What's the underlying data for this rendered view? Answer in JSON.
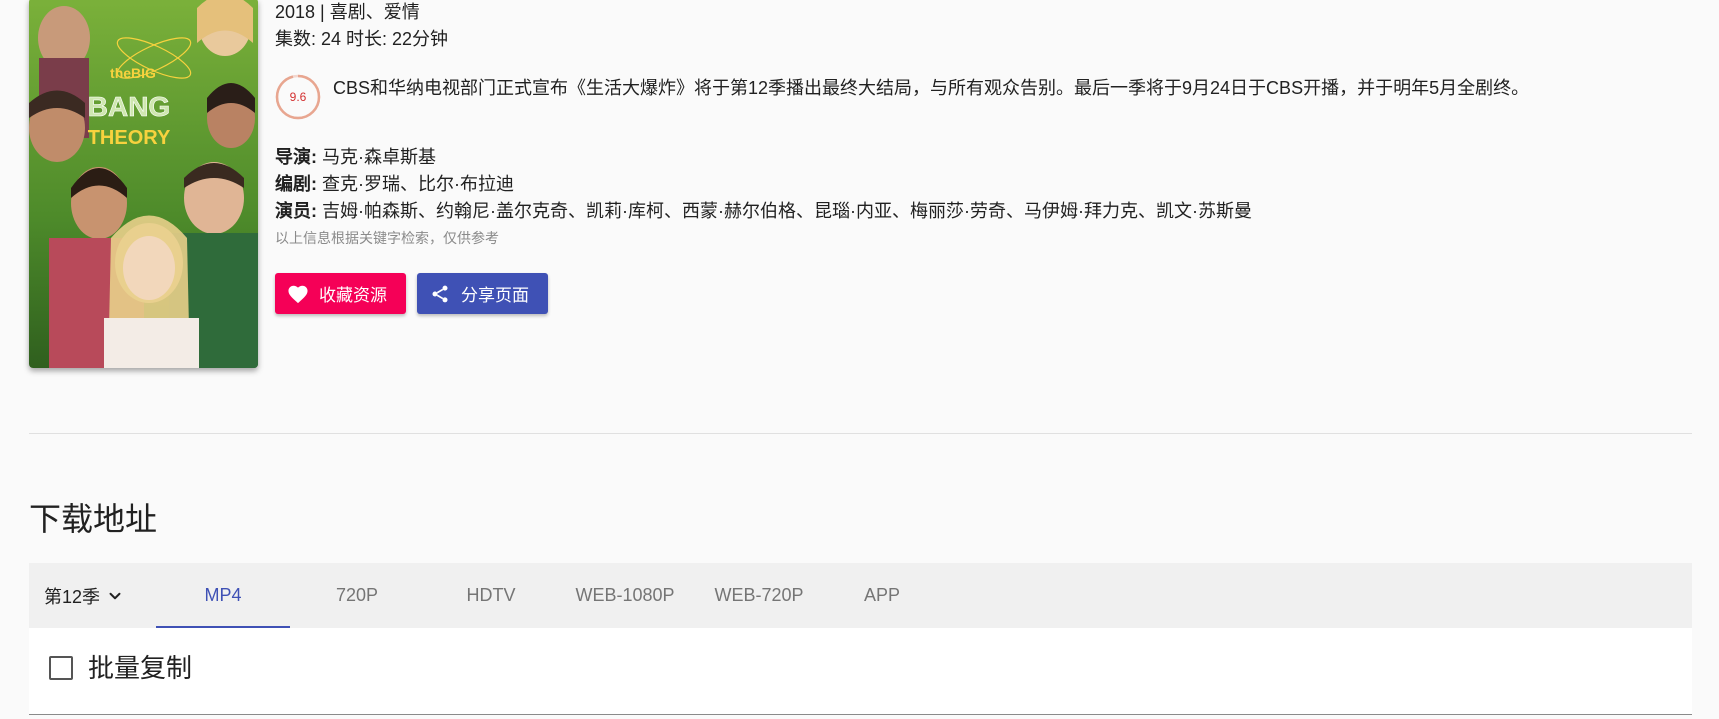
{
  "show": {
    "poster_title_line1": "theBIG",
    "poster_title_line2": "BANG",
    "poster_title_line3": "THEORY",
    "year_genre": "2018 | 喜剧、爱情",
    "episodes_duration": "集数: 24 时长: 22分钟",
    "rating": "9.6",
    "rating_fraction": 0.96,
    "description": "CBS和华纳电视部门正式宣布《生活大爆炸》将于第12季播出最终大结局，与所有观众告别。最后一季将于9月24日于CBS开播，并于明年5月全剧终。",
    "director_label": "导演:",
    "director": "马克·森卓斯基",
    "writer_label": "编剧:",
    "writer": "查克·罗瑞、比尔·布拉迪",
    "cast_label": "演员:",
    "cast": "吉姆·帕森斯、约翰尼·盖尔克奇、凯莉·库柯、西蒙·赫尔伯格、昆瑙·内亚、梅丽莎·劳奇、马伊姆·拜力克、凯文·苏斯曼",
    "notice": "以上信息根据关键字检索，仅供参考"
  },
  "actions": {
    "favorite_label": "收藏资源",
    "share_label": "分享页面"
  },
  "download": {
    "title": "下载地址",
    "season": "第12季",
    "tabs": [
      "MP4",
      "720P",
      "HDTV",
      "WEB-1080P",
      "WEB-720P",
      "APP"
    ],
    "active_tab": "MP4",
    "batch_copy_label": "批量复制"
  },
  "colors": {
    "favorite": "#f50057",
    "share": "#3f51b5",
    "active_tab": "#3f51b5",
    "rating": "#d32f2f"
  },
  "icons": {
    "favorite": "heart-icon",
    "share": "share-icon",
    "season_dropdown": "chevron-down-icon",
    "batch": "checkbox"
  }
}
